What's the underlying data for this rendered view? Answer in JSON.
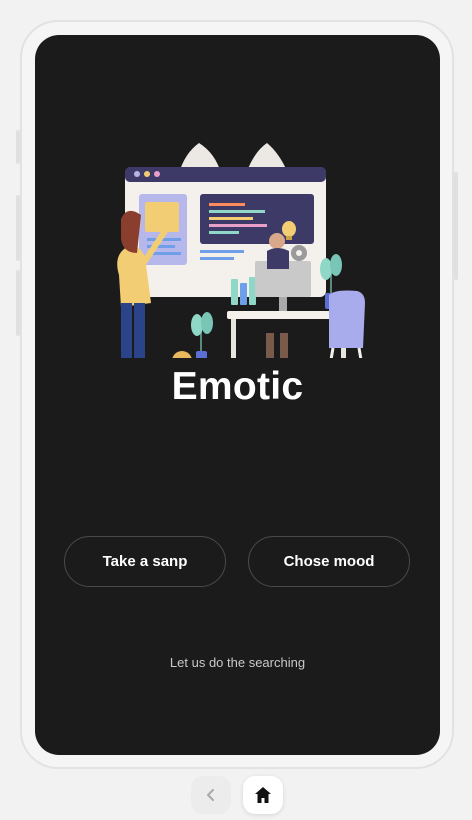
{
  "app": {
    "title": "Emotic"
  },
  "actions": {
    "snap_label": "Take a sanp",
    "mood_label": "Chose mood"
  },
  "tagline": "Let us do the searching",
  "nav": {
    "back_icon": "chevron-left-icon",
    "home_icon": "home-icon"
  },
  "colors": {
    "screen_bg": "#1b1b1b",
    "text": "#ffffff",
    "button_border": "#4a4a4a"
  }
}
